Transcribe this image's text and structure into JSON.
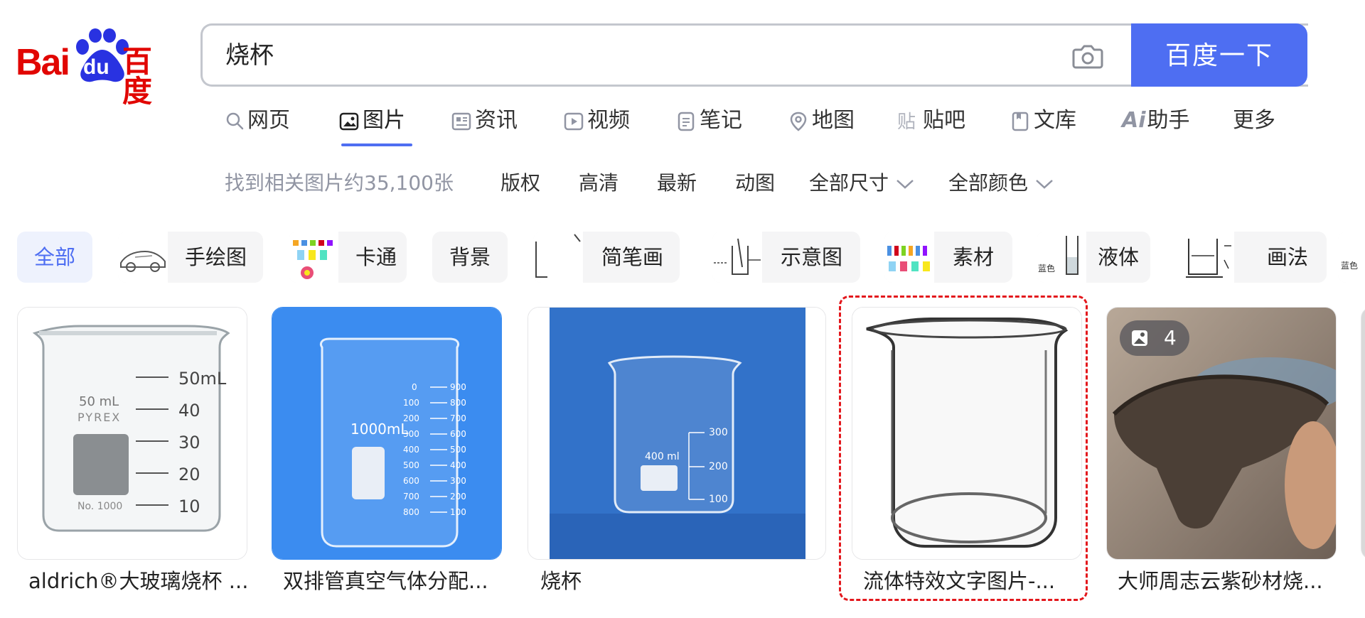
{
  "logo": {
    "latin": "Bai",
    "du": "du",
    "chinese": "百度"
  },
  "search": {
    "query": "烧杯",
    "button_label": "百度一下",
    "camera_icon": "camera-icon"
  },
  "nav": {
    "tabs": [
      {
        "label": "网页",
        "icon": "search-icon"
      },
      {
        "label": "图片",
        "icon": "image-icon",
        "active": true
      },
      {
        "label": "资讯",
        "icon": "news-icon"
      },
      {
        "label": "视频",
        "icon": "play-icon"
      },
      {
        "label": "笔记",
        "icon": "note-icon"
      },
      {
        "label": "地图",
        "icon": "map-pin-icon"
      },
      {
        "label": "贴吧",
        "icon": "tieba-icon"
      },
      {
        "label": "文库",
        "icon": "doc-icon"
      },
      {
        "label": "助手",
        "icon": "ai-icon",
        "prefix": "Ai"
      },
      {
        "label": "更多"
      }
    ]
  },
  "filters": {
    "result_count": "找到相关图片约35,100张",
    "items": [
      "版权",
      "高清",
      "最新",
      "动图"
    ],
    "size_dropdown": "全部尺寸",
    "color_dropdown": "全部颜色"
  },
  "chips": [
    {
      "label": "全部",
      "active": true
    },
    {
      "label": "手绘图"
    },
    {
      "label": "卡通"
    },
    {
      "label": "背景"
    },
    {
      "label": "简笔画"
    },
    {
      "label": "示意图"
    },
    {
      "label": "素材"
    },
    {
      "label": "液体",
      "thumb_text": "蓝色"
    },
    {
      "label": "画法"
    }
  ],
  "chip_extra_thumb_text": "蓝色",
  "images": [
    {
      "caption": "aldrich®大玻璃烧杯 ...",
      "scale_labels": [
        "50mL",
        "40",
        "30",
        "20",
        "10"
      ],
      "brand_text": [
        "50 mL",
        "PYREX",
        "No. 1000"
      ]
    },
    {
      "caption": "双排管真空气体分配...",
      "scale_left": [
        "0",
        "100",
        "200",
        "300",
        "400",
        "500",
        "600",
        "700",
        "800"
      ],
      "scale_right": [
        "900",
        "800",
        "700",
        "600",
        "500",
        "400",
        "300",
        "200",
        "100"
      ],
      "volume_text": "1000mL"
    },
    {
      "caption": "烧杯",
      "volume_text": "400 ml",
      "scale_labels": [
        "300",
        "200",
        "100"
      ]
    },
    {
      "caption": "流体特效文字图片-...",
      "highlighted": true
    },
    {
      "caption": "大师周志云紫砂材烧...",
      "badge_count": "4"
    }
  ],
  "colors": {
    "accent": "#4e6ef2",
    "brand_red": "#e10602",
    "highlight": "#e3171c",
    "card_blue": "#3b8cf0"
  }
}
